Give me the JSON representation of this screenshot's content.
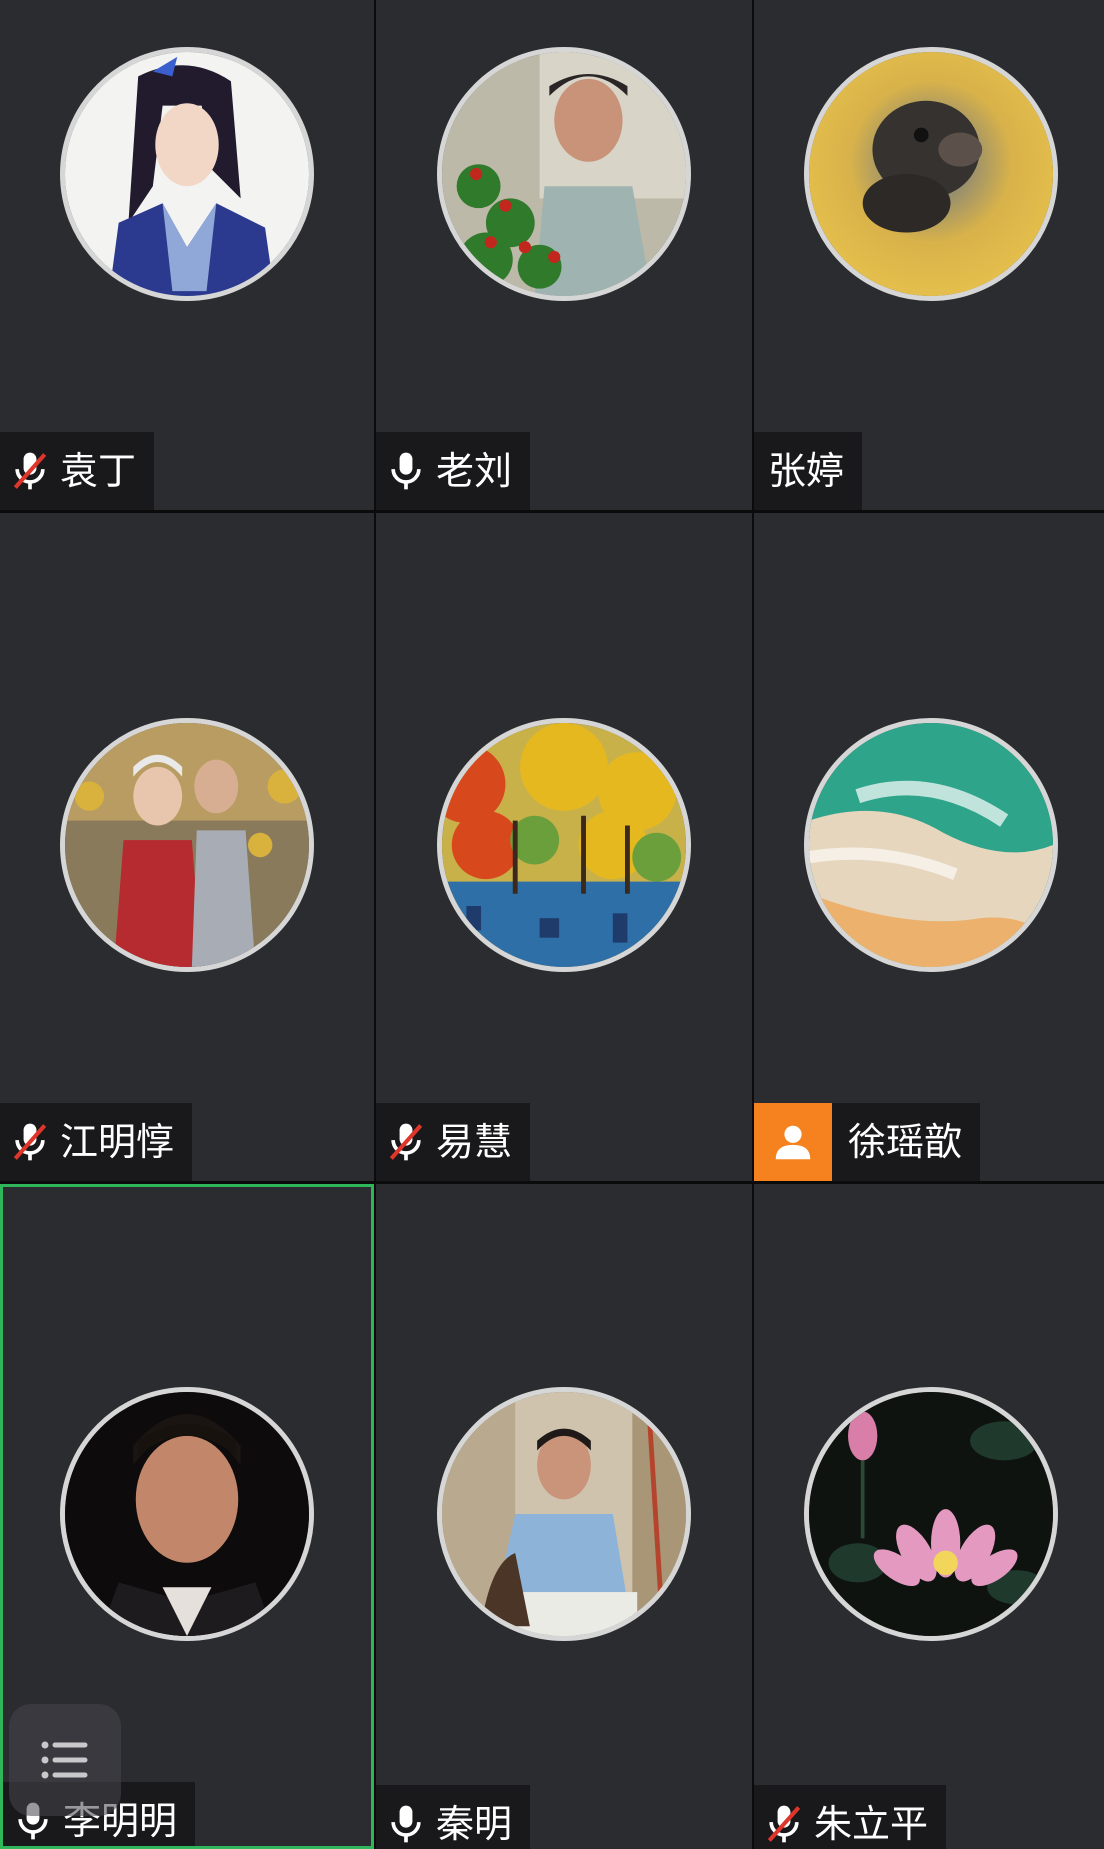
{
  "participants": [
    {
      "name": "袁丁",
      "mic": "muted"
    },
    {
      "name": "老刘",
      "mic": "on"
    },
    {
      "name": "张婷",
      "mic": "none"
    },
    {
      "name": "江明惇",
      "mic": "muted"
    },
    {
      "name": "易慧",
      "mic": "muted"
    },
    {
      "name": "徐瑶歆",
      "mic": "person"
    },
    {
      "name": "李明明",
      "mic": "on",
      "active_speaker": true
    },
    {
      "name": "秦明",
      "mic": "on"
    },
    {
      "name": "朱立平",
      "mic": "muted"
    }
  ],
  "colors": {
    "tile_background": "#2b2c30",
    "active_border": "#2fb65a",
    "muted_slash": "#e0352b",
    "person_badge": "#f5821f"
  },
  "icons": {
    "mic_on": "microphone-icon",
    "mic_muted": "microphone-muted-icon",
    "person": "person-icon",
    "list": "participant-list-icon"
  }
}
